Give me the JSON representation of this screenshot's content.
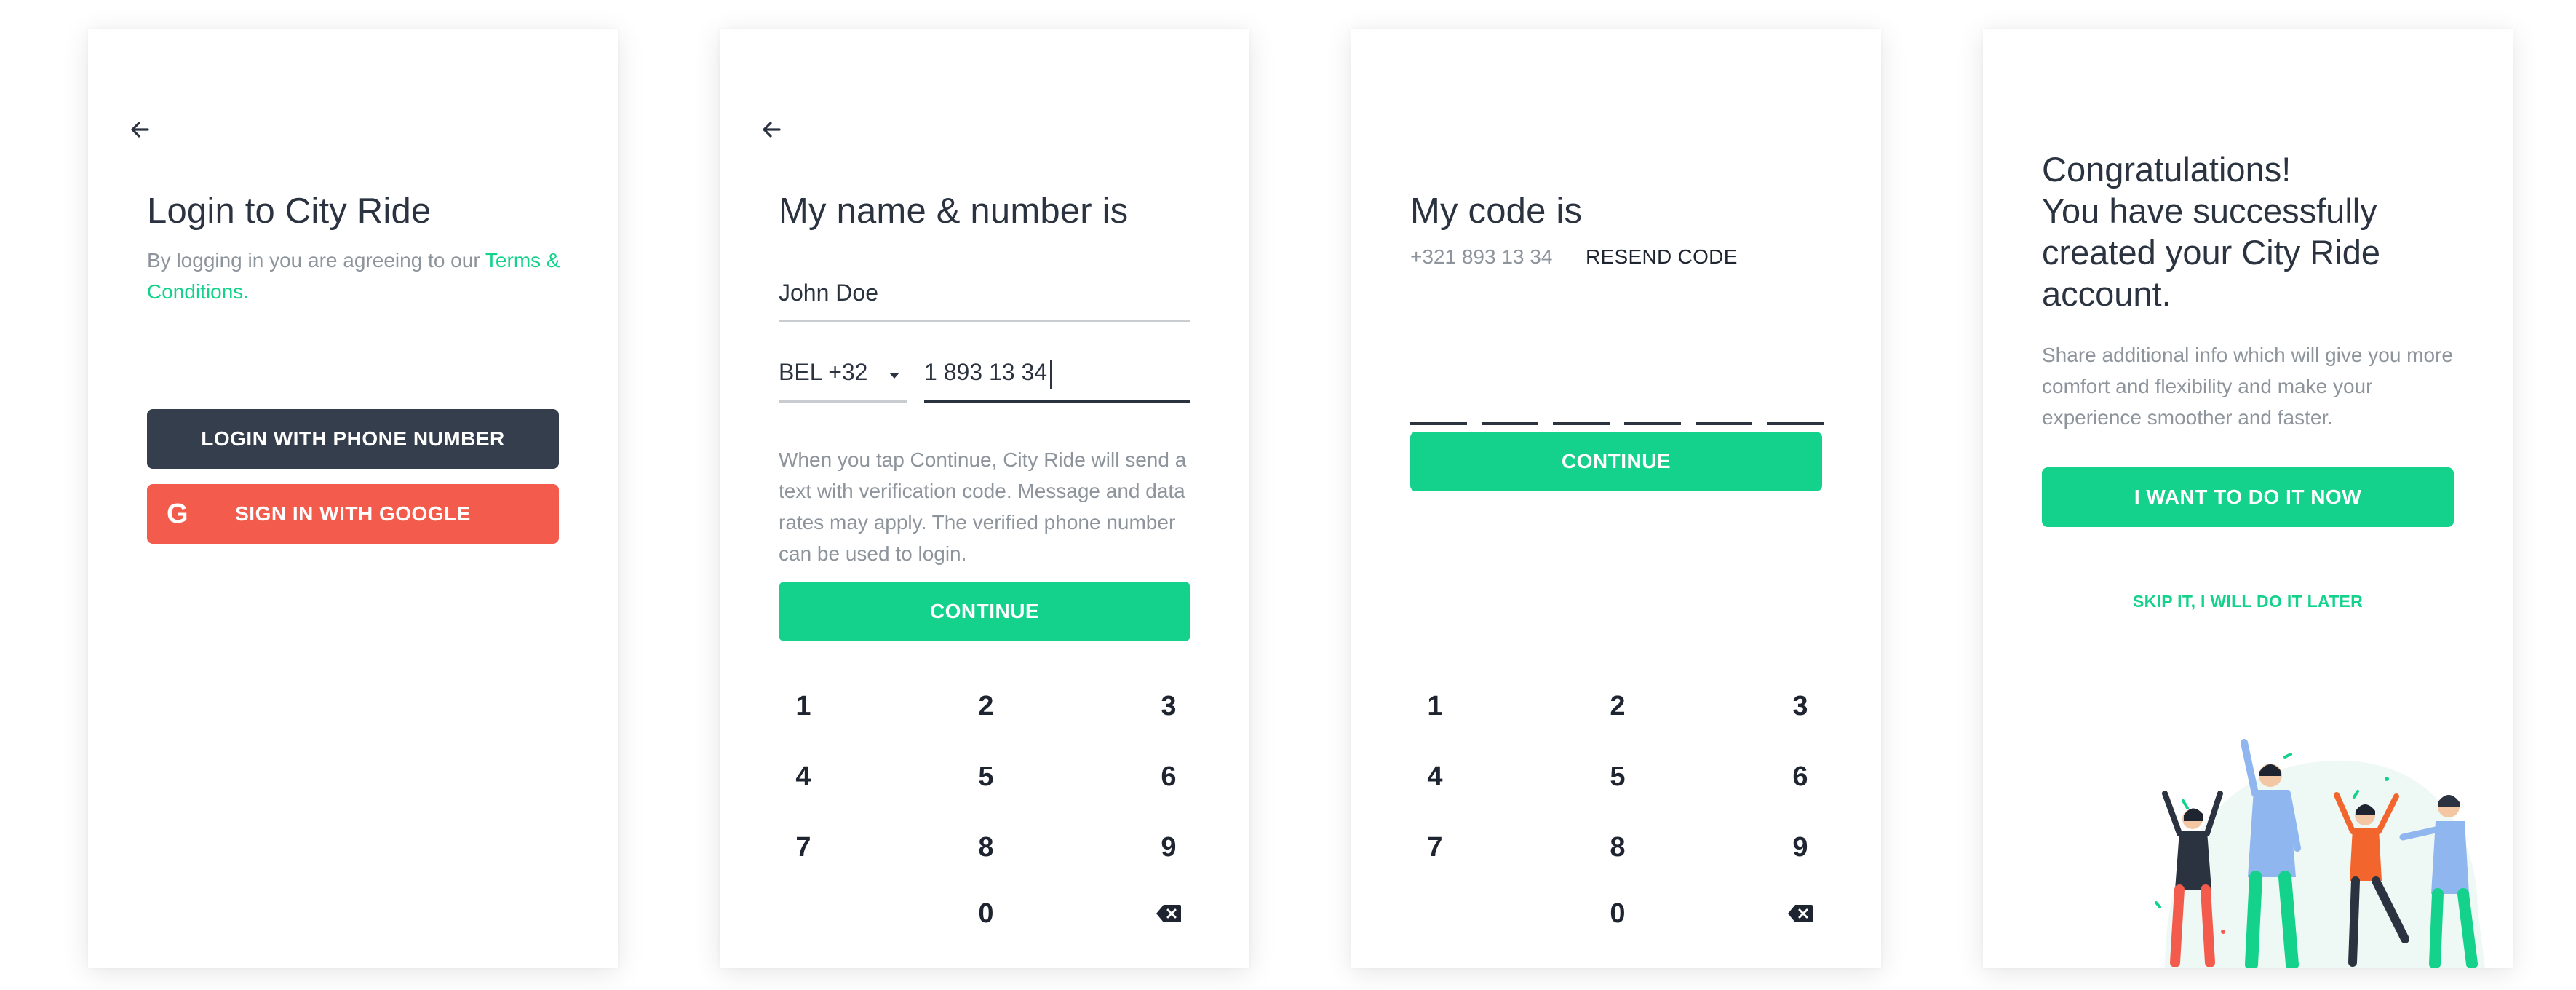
{
  "screen1": {
    "title": "Login to City Ride",
    "subtitle_text": "By logging in you are agreeing to our ",
    "terms_link": "Terms & Conditions.",
    "phone_button": "LOGIN WITH PHONE NUMBER",
    "google_button": "SIGN IN WITH GOOGLE",
    "google_icon": "G"
  },
  "screen2": {
    "title": "My name & number is",
    "name_value": "John Doe",
    "country_code": "BEL +32",
    "phone_value": "1 893 13 34",
    "info": "When you tap Continue, City Ride will send a text with verification code. Message and data rates may apply. The verified phone number can be used to login.",
    "continue_button": "CONTINUE",
    "keys": [
      "1",
      "2",
      "3",
      "4",
      "5",
      "6",
      "7",
      "8",
      "9",
      "0"
    ]
  },
  "screen3": {
    "title": "My code is",
    "phone": "+321 893 13 34",
    "resend": "RESEND CODE",
    "continue_button": "CONTINUE",
    "keys": [
      "1",
      "2",
      "3",
      "4",
      "5",
      "6",
      "7",
      "8",
      "9",
      "0"
    ]
  },
  "screen4": {
    "title_lines": [
      "Congratulations!",
      "You have successfully",
      "created your City Ride",
      "account."
    ],
    "subtitle": "Share additional info which will give you more comfort and flexibility and make your experience smoother and faster.",
    "primary_button": "I WANT TO DO IT NOW",
    "skip_link": "SKIP IT, I WILL DO IT LATER"
  },
  "icons": {
    "back": "arrow-left-icon",
    "dropdown": "caret-down-icon",
    "backspace": "backspace-icon",
    "google": "google-icon"
  },
  "colors": {
    "accent_green": "#14d28b",
    "dark_button": "#353e4d",
    "google_red": "#f35b4c",
    "text_dark": "#2b3340",
    "text_muted": "#8d949c"
  }
}
